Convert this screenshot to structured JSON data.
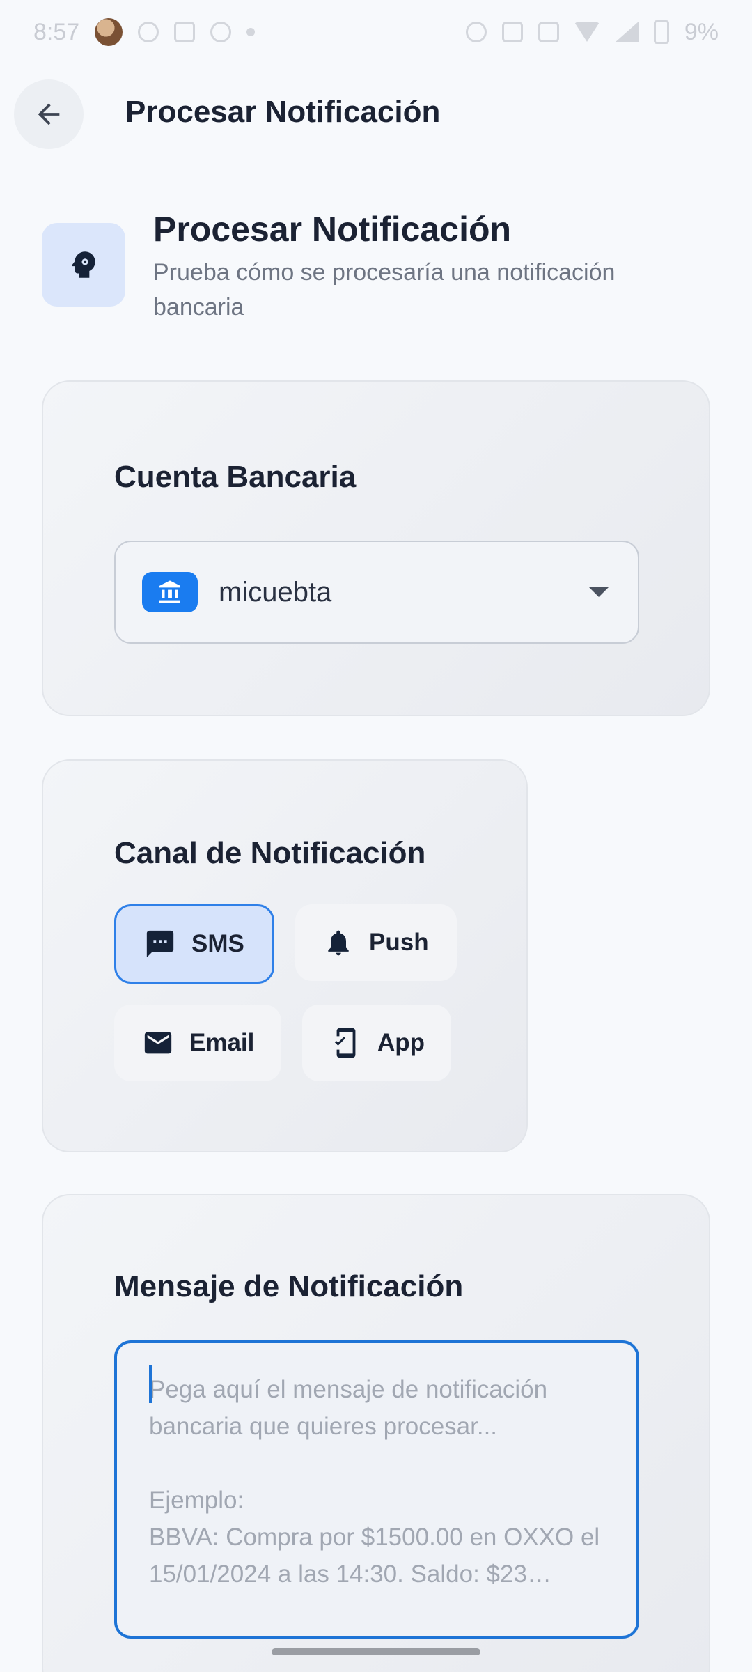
{
  "status_bar": {
    "time": "8:57",
    "battery": "9%"
  },
  "app_bar": {
    "title": "Procesar Notificación"
  },
  "header": {
    "title": "Procesar Notificación",
    "subtitle": "Prueba cómo se procesaría una notificación bancaria"
  },
  "account_card": {
    "title": "Cuenta Bancaria",
    "selected_account": "micuebta"
  },
  "channel_card": {
    "title": "Canal de Notificación",
    "options": [
      {
        "label": "SMS",
        "icon": "sms-icon",
        "selected": true
      },
      {
        "label": "Push",
        "icon": "bell-icon",
        "selected": false
      },
      {
        "label": "Email",
        "icon": "email-icon",
        "selected": false
      },
      {
        "label": "App",
        "icon": "mobile-app-icon",
        "selected": false
      }
    ]
  },
  "message_card": {
    "title": "Mensaje de Notificación",
    "placeholder": "Pega aquí el mensaje de notificación bancaria que quieres procesar...\n\nEjemplo:\nBBVA: Compra por $1500.00 en OXXO el 15/01/2024 a las 14:30. Saldo: $23…",
    "value": ""
  },
  "colors": {
    "accent": "#1e74d6",
    "bank_badge": "#1a7cf0",
    "chip_selected_bg": "#d6e3fb"
  }
}
